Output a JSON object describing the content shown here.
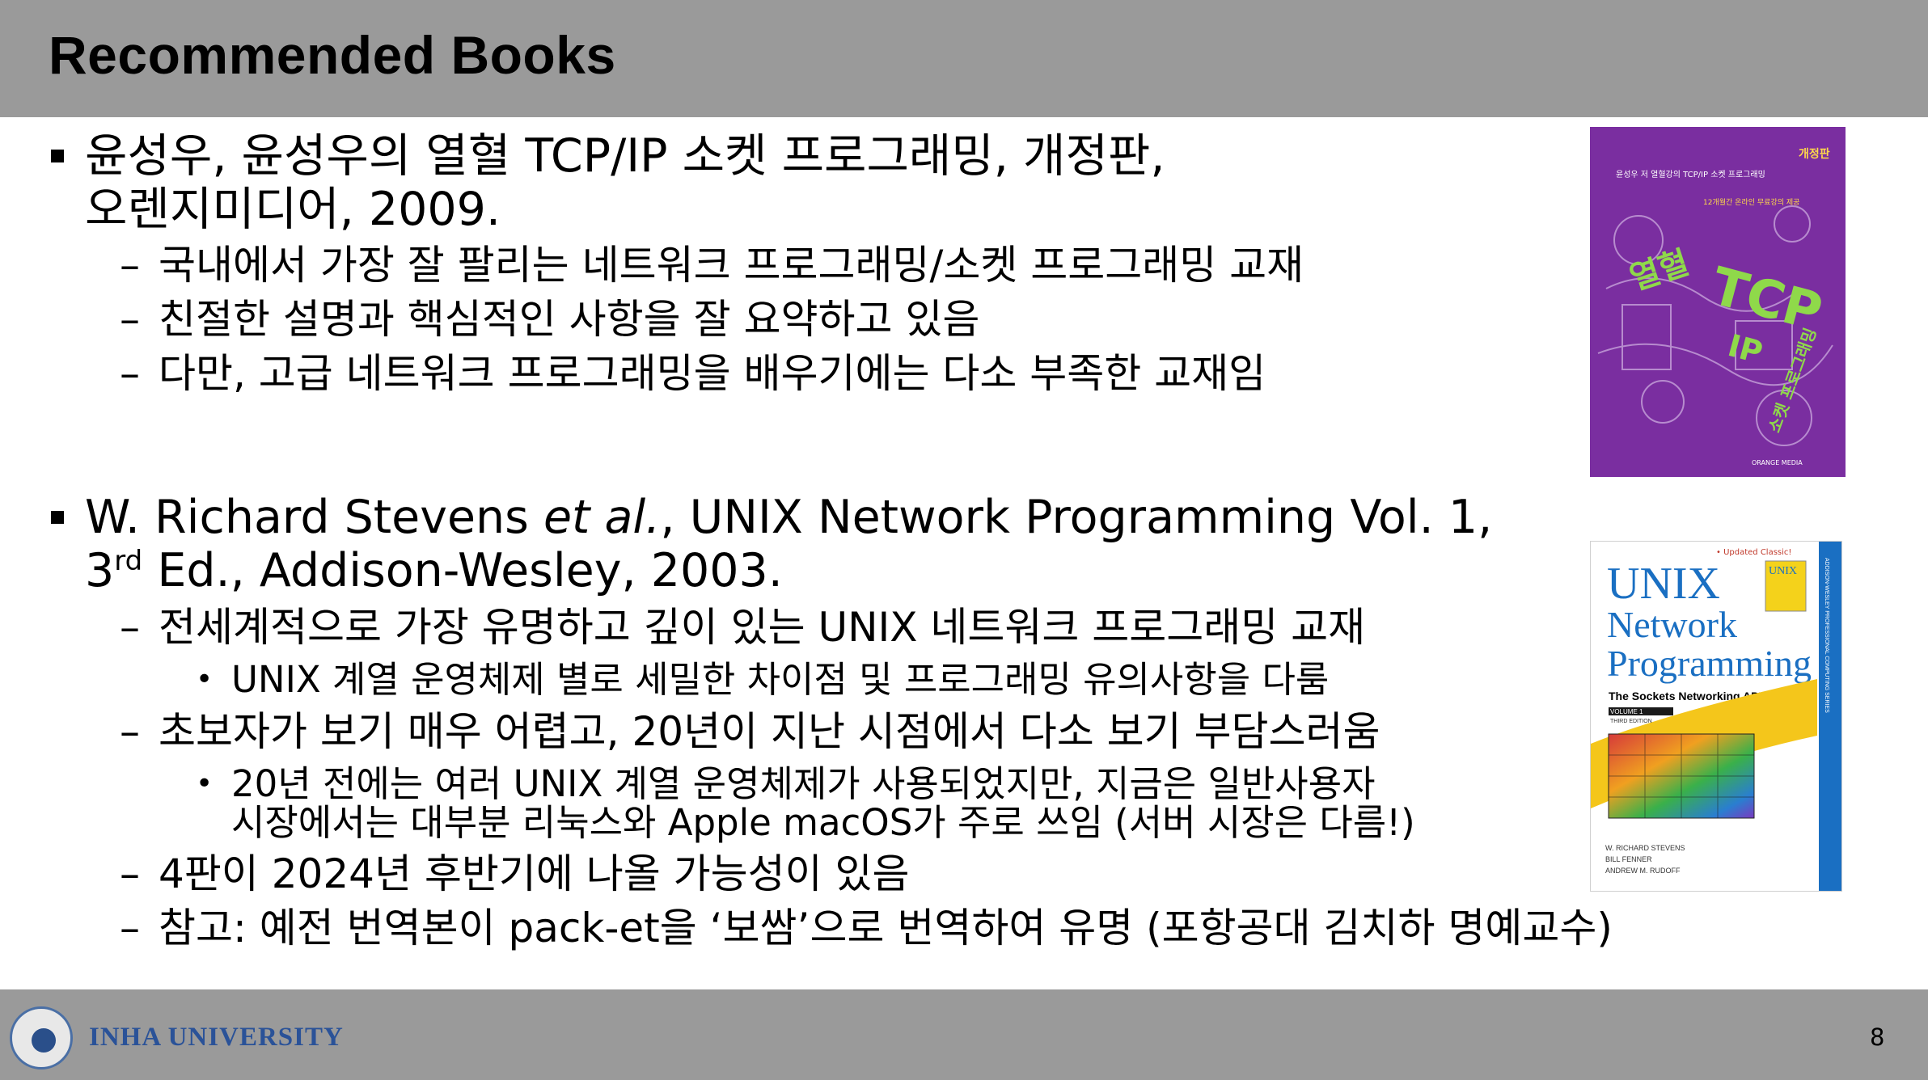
{
  "slide": {
    "title": "Recommended Books",
    "page_number": "8",
    "footer_university": "INHA UNIVERSITY"
  },
  "book1": {
    "line1": "윤성우, 윤성우의 열혈 TCP/IP 소켓 프로그래밍, 개정판,",
    "line2": "오렌지미디어, 2009.",
    "points": [
      "국내에서 가장 잘 팔리는 네트워크 프로그래밍/소켓 프로그래밍 교재",
      "친절한 설명과 핵심적인 사항을 잘 요약하고 있음",
      "다만, 고급 네트워크 프로그래밍을 배우기에는 다소 부족한 교재임"
    ],
    "cover": {
      "badge": "개정판",
      "subtitle": "윤성우 저 열혈강의 TCP/IP 소켓 프로그래밍",
      "tagline": "12개월간 온라인 무료강의 제공",
      "big1": "열혈",
      "big2": "TCP",
      "big3": "IP",
      "big4": "소켓 프로그래밍",
      "publisher": "ORANGE MEDIA"
    }
  },
  "book2": {
    "author": "W. Richard Stevens ",
    "etal": "et al.",
    "rest1": ", UNIX Network Programming Vol. 1,",
    "ed_num": "3",
    "ed_sup": "rd",
    "rest2": " Ed., Addison-Wesley, 2003.",
    "p1": "전세계적으로 가장 유명하고 깊이 있는 UNIX 네트워크 프로그래밍 교재",
    "p1_sub": "UNIX 계열 운영체제 별로 세밀한 차이점 및 프로그래밍 유의사항을 다룸",
    "p2": "초보자가 보기 매우 어렵고, 20년이 지난 시점에서 다소 보기 부담스러움",
    "p2_sub1": "20년 전에는 여러 UNIX 계열 운영체제가 사용되었지만, 지금은 일반사용자",
    "p2_sub2": "시장에서는 대부분 리눅스와 Apple macOS가 주로 쓰임 (서버 시장은 다름!)",
    "p3": "4판이 2024년 후반기에 나올 가능성이 있음",
    "p4": "참고: 예전 번역본이 pack-et을 ‘보쌈’으로 번역하여 유명 (포항공대 김치하 명예교수)",
    "cover": {
      "updated": "• Updated Classic!",
      "title1": "UNIX",
      "title2": "Network",
      "title3": "Programming",
      "subtitle": "The Sockets Networking API",
      "volume": "VOLUME 1",
      "edition": "THIRD EDITION",
      "author1": "W. RICHARD STEVENS",
      "author2": "BILL FENNER",
      "author3": "ANDREW M. RUDOFF",
      "series": "ADDISON-WESLEY PROFESSIONAL COMPUTING SERIES"
    }
  },
  "colors": {
    "header_bg": "#9a9a9a",
    "cover1_bg": "#7a2ea0",
    "cover2_accent": "#1a6fc2"
  }
}
